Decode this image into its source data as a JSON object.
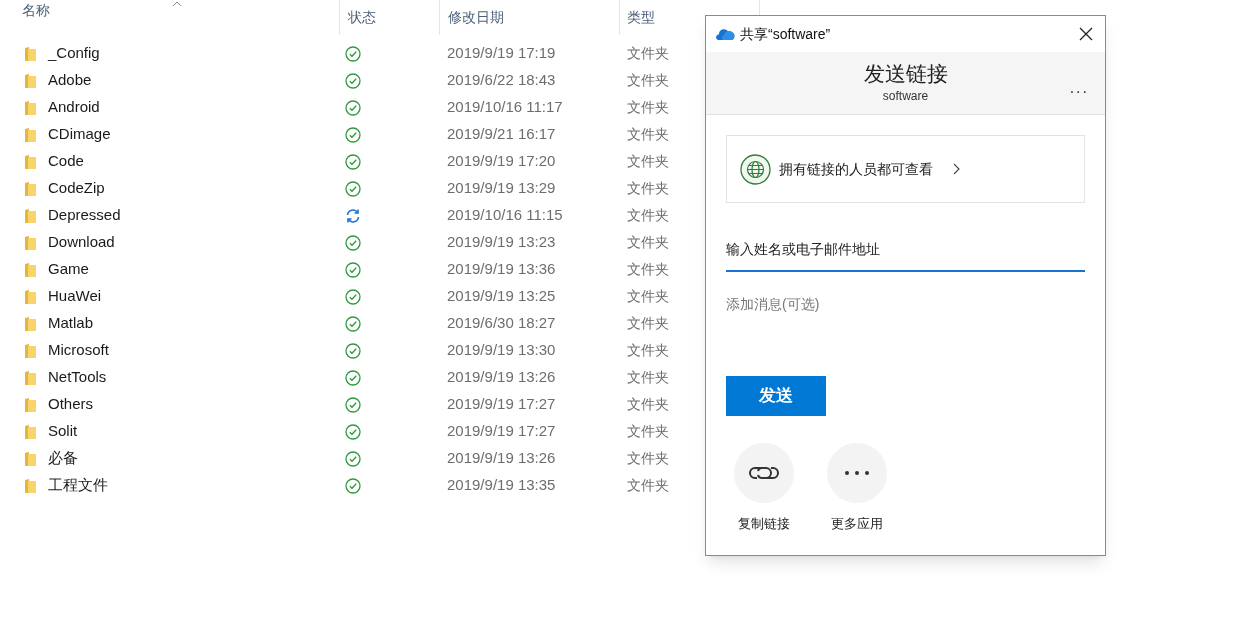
{
  "columns": [
    {
      "label": "名称",
      "sorted": true
    },
    {
      "label": "状态",
      "sorted": false
    },
    {
      "label": "修改日期",
      "sorted": false
    },
    {
      "label": "类型",
      "sorted": false
    }
  ],
  "rows": [
    {
      "name": "_Config",
      "kind": "synced",
      "date": "2019/9/19 17:19",
      "type": "文件夹"
    },
    {
      "name": "Adobe",
      "kind": "synced",
      "date": "2019/6/22 18:43",
      "type": "文件夹"
    },
    {
      "name": "Android",
      "kind": "synced",
      "date": "2019/10/16 11:17",
      "type": "文件夹"
    },
    {
      "name": "CDimage",
      "kind": "synced",
      "date": "2019/9/21 16:17",
      "type": "文件夹"
    },
    {
      "name": "Code",
      "kind": "synced",
      "date": "2019/9/19 17:20",
      "type": "文件夹"
    },
    {
      "name": "CodeZip",
      "kind": "synced",
      "date": "2019/9/19 13:29",
      "type": "文件夹"
    },
    {
      "name": "Depressed",
      "kind": "syncing",
      "date": "2019/10/16 11:15",
      "type": "文件夹"
    },
    {
      "name": "Download",
      "kind": "synced",
      "date": "2019/9/19 13:23",
      "type": "文件夹"
    },
    {
      "name": "Game",
      "kind": "synced",
      "date": "2019/9/19 13:36",
      "type": "文件夹"
    },
    {
      "name": "HuaWei",
      "kind": "synced",
      "date": "2019/9/19 13:25",
      "type": "文件夹"
    },
    {
      "name": "Matlab",
      "kind": "synced",
      "date": "2019/6/30 18:27",
      "type": "文件夹"
    },
    {
      "name": "Microsoft",
      "kind": "synced",
      "date": "2019/9/19 13:30",
      "type": "文件夹"
    },
    {
      "name": "NetTools",
      "kind": "synced",
      "date": "2019/9/19 13:26",
      "type": "文件夹"
    },
    {
      "name": "Others",
      "kind": "synced",
      "date": "2019/9/19 17:27",
      "type": "文件夹"
    },
    {
      "name": "Solit",
      "kind": "synced",
      "date": "2019/9/19 17:27",
      "type": "文件夹"
    },
    {
      "name": "必备",
      "kind": "synced",
      "date": "2019/9/19 13:26",
      "type": "文件夹"
    },
    {
      "name": "工程文件",
      "kind": "synced",
      "date": "2019/9/19 13:35",
      "type": "文件夹"
    }
  ],
  "dialog": {
    "title": "共享“software”",
    "heading": "发送链接",
    "subheading": "software",
    "more": "...",
    "permission": "拥有链接的人员都可查看",
    "recipient_placeholder": "输入姓名或电子邮件地址",
    "message_placeholder": "添加消息(可选)",
    "send_button": "发送",
    "actions": [
      {
        "kind": "link",
        "label": "复制链接"
      },
      {
        "kind": "more",
        "label": "更多应用"
      }
    ]
  }
}
